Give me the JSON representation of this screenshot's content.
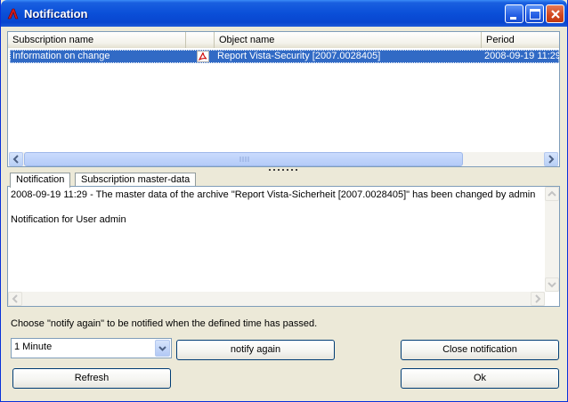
{
  "window": {
    "title": "Notification"
  },
  "list": {
    "columns": [
      "Subscription name",
      "",
      "Object name",
      "Period"
    ],
    "rows": [
      {
        "subscription": "Information on change",
        "icon": "pdf-icon",
        "object": "Report Vista-Security [2007.0028405]",
        "period": "2008-09-19 11:29"
      }
    ]
  },
  "tabs": [
    "Notification",
    "Subscription master-data"
  ],
  "message": {
    "line1": "2008-09-19 11:29 - The master data of the archive \"Report Vista-Sicherheit [2007.0028405]\" has been changed by admin",
    "line2": "",
    "line3": "Notification for User admin"
  },
  "hint": "Choose \"notify again\" to be notified when the defined time has passed.",
  "interval": {
    "selected": "1 Minute"
  },
  "buttons": {
    "notify_again": "notify again",
    "close_notification": "Close notification",
    "refresh": "Refresh",
    "ok": "Ok"
  },
  "colors": {
    "selection": "#316ac5",
    "titlebar": "#0a4fd8"
  }
}
